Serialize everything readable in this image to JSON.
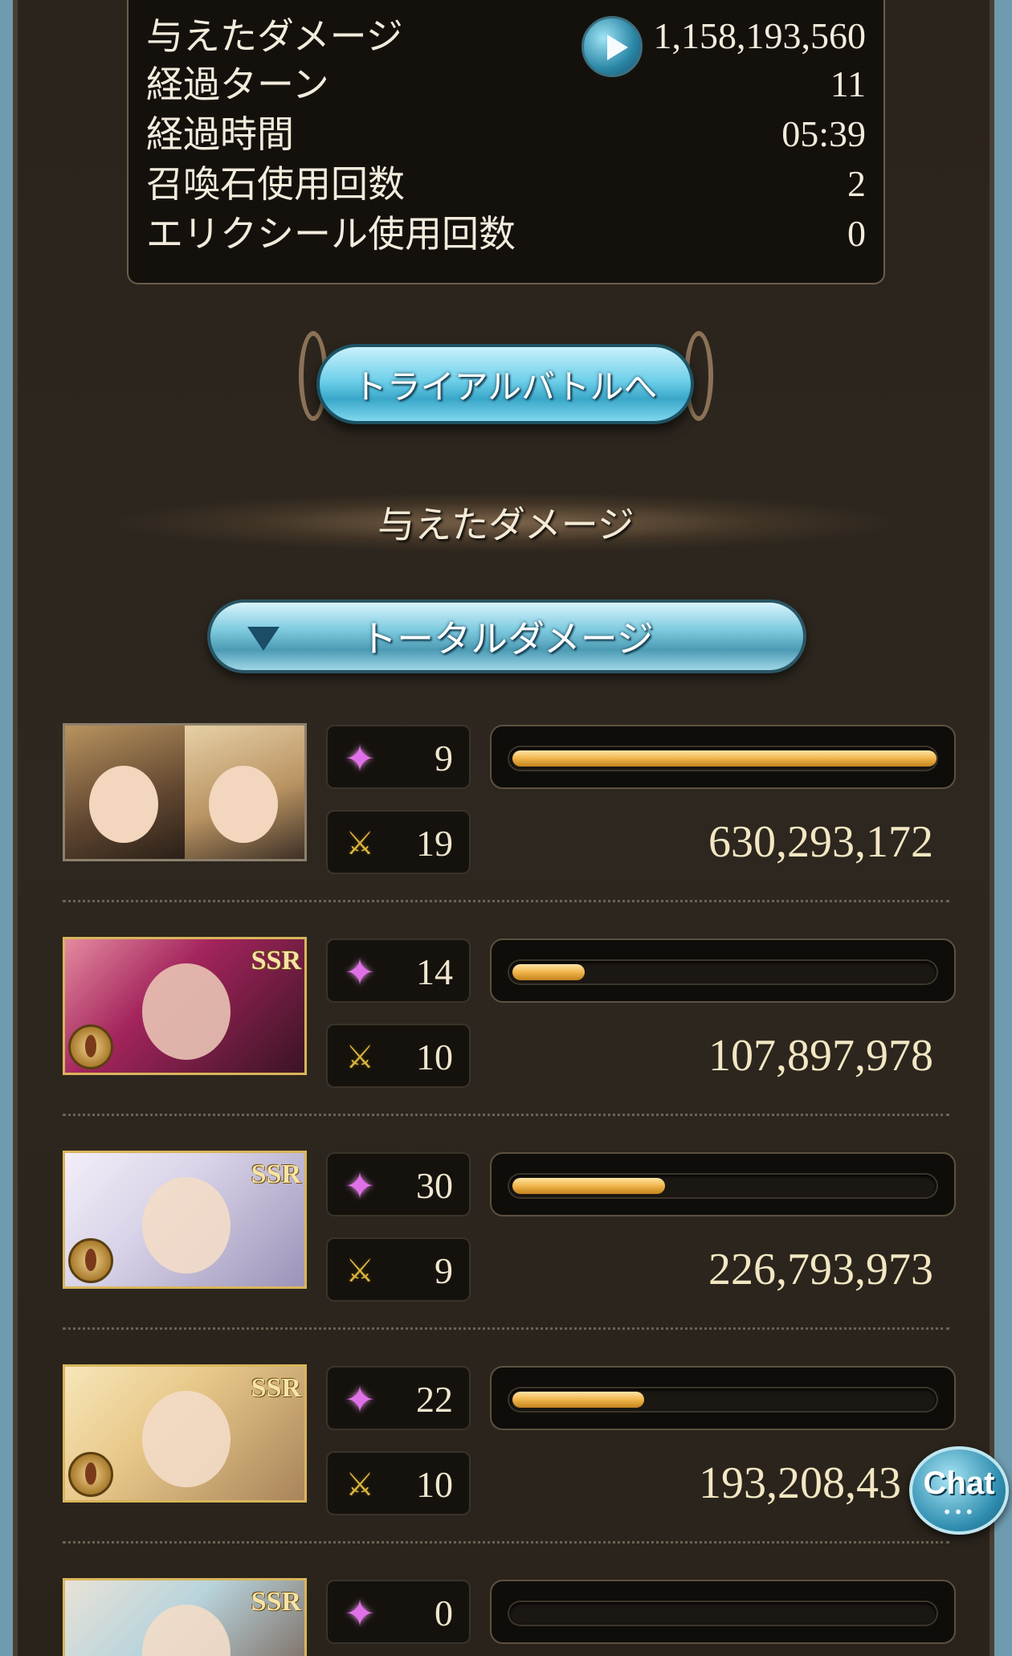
{
  "battle_stats": {
    "rows": [
      {
        "label": "与えたダメージ",
        "value": "1,158,193,560"
      },
      {
        "label": "経過ターン",
        "value": "11"
      },
      {
        "label": "経過時間",
        "value": "05:39"
      },
      {
        "label": "召喚石使用回数",
        "value": "2"
      },
      {
        "label": "エリクシール使用回数",
        "value": "0"
      }
    ],
    "play_icon": "play-icon"
  },
  "trial_button": {
    "label": "トライアルバトルへ"
  },
  "section": {
    "title": "与えたダメージ"
  },
  "dropdown": {
    "label": "トータルダメージ",
    "icon": "triangle-down-icon"
  },
  "icons": {
    "ability": "sparkle-star-icon",
    "attack": "crossed-swords-icon"
  },
  "members": [
    {
      "ability_count": "9",
      "attack_count": "19",
      "damage": "630,293,172",
      "bar_fraction": 1.0,
      "rarity": "",
      "dual": true
    },
    {
      "ability_count": "14",
      "attack_count": "10",
      "damage": "107,897,978",
      "bar_fraction": 0.17,
      "rarity": "SSR",
      "dual": false
    },
    {
      "ability_count": "30",
      "attack_count": "9",
      "damage": "226,793,973",
      "bar_fraction": 0.36,
      "rarity": "SSR",
      "dual": false
    },
    {
      "ability_count": "22",
      "attack_count": "10",
      "damage": "193,208,43",
      "bar_fraction": 0.31,
      "rarity": "SSR",
      "dual": false
    },
    {
      "ability_count": "0",
      "attack_count": "",
      "damage": "",
      "bar_fraction": 0.0,
      "rarity": "SSR",
      "dual": false
    }
  ],
  "chat": {
    "label": "Chat",
    "dots": "•••"
  }
}
